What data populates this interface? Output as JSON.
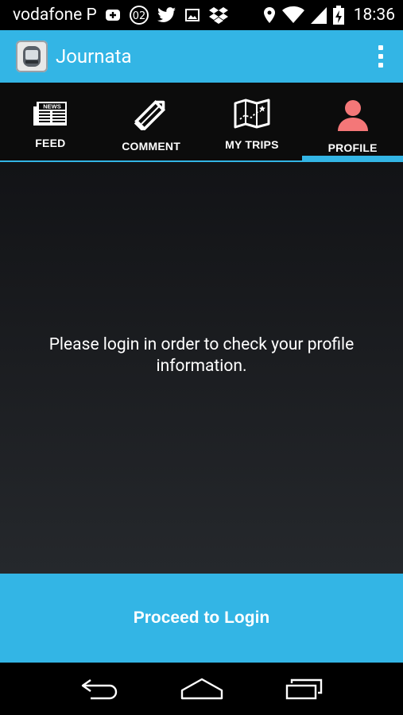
{
  "status_bar": {
    "carrier": "vodafone P",
    "time": "18:36",
    "left_icons": [
      "plus-badge-icon",
      "o2-icon",
      "twitter-icon",
      "image-icon",
      "dropbox-icon"
    ],
    "right_icons": [
      "location-icon",
      "wifi-icon",
      "signal-icon",
      "battery-charging-icon"
    ]
  },
  "action_bar": {
    "title": "Journata",
    "app_icon": "journata-app-icon",
    "overflow_icon": "overflow-menu-icon"
  },
  "tabs": [
    {
      "label": "FEED",
      "icon": "newspaper-icon",
      "active": false
    },
    {
      "label": "COMMENT",
      "icon": "pencil-icon",
      "active": false
    },
    {
      "label": "MY TRIPS",
      "icon": "map-icon",
      "active": false
    },
    {
      "label": "PROFILE",
      "icon": "person-icon",
      "active": true
    }
  ],
  "main": {
    "message": "Please login in order to check your profile information."
  },
  "login_button": {
    "label": "Proceed to Login"
  },
  "colors": {
    "accent": "#33b5e5",
    "profile_icon": "#f47778",
    "tab_bar_bg": "#0c0c0c"
  },
  "nav_bar": {
    "icons": [
      "back-icon",
      "home-icon",
      "recent-apps-icon"
    ]
  }
}
